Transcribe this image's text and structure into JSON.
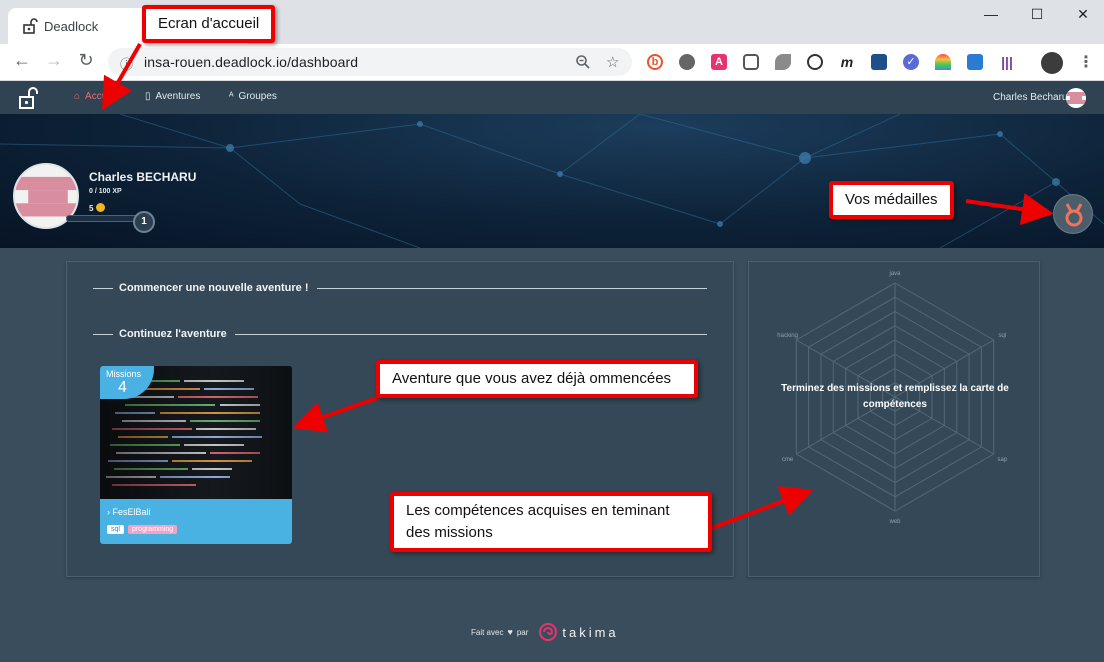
{
  "browser": {
    "tab_title": "Deadlock",
    "url": "insa-rouen.deadlock.io/dashboard",
    "win_minimize": "—",
    "win_maximize": "☐",
    "win_close": "✕",
    "new_tab": "+",
    "tab_close": "×"
  },
  "nav": {
    "home": "Accueil",
    "adventures": "Aventures",
    "groups": "Groupes",
    "user": "Charles Becharu"
  },
  "profile": {
    "name": "Charles BECHARU",
    "xp": "0 / 100 XP",
    "coins": "5",
    "level": "1",
    "xp_progress": 0
  },
  "dashboard": {
    "new_adventure_title": "Commencer une nouvelle aventure !",
    "continue_title": "Continuez l'aventure",
    "card": {
      "missions_label": "Missions",
      "missions_count": "4",
      "title": "FesElBali",
      "tags": [
        "sql",
        "programming"
      ]
    },
    "skills": {
      "axes": [
        "java",
        "sql",
        "sap",
        "web",
        "cme",
        "hacking"
      ],
      "message": "Terminez des missions et remplissez la carte de compétences"
    }
  },
  "footer": {
    "made_with": "Fait avec",
    "heart": "♥",
    "by": "par",
    "brand": "takima"
  },
  "annotations": {
    "home_screen": "Ecran d'accueil",
    "medals": "Vos médailles",
    "started_adventures": "Aventure que vous avez déjà ommencées",
    "skills_acquired": "Les compétences acquises en teminant des missions"
  },
  "colors": {
    "accent_active": "#ef6a6a",
    "card_blue": "#49b2e3",
    "annotation_red": "#e00000",
    "tag_pink": "#f4a3c5"
  }
}
